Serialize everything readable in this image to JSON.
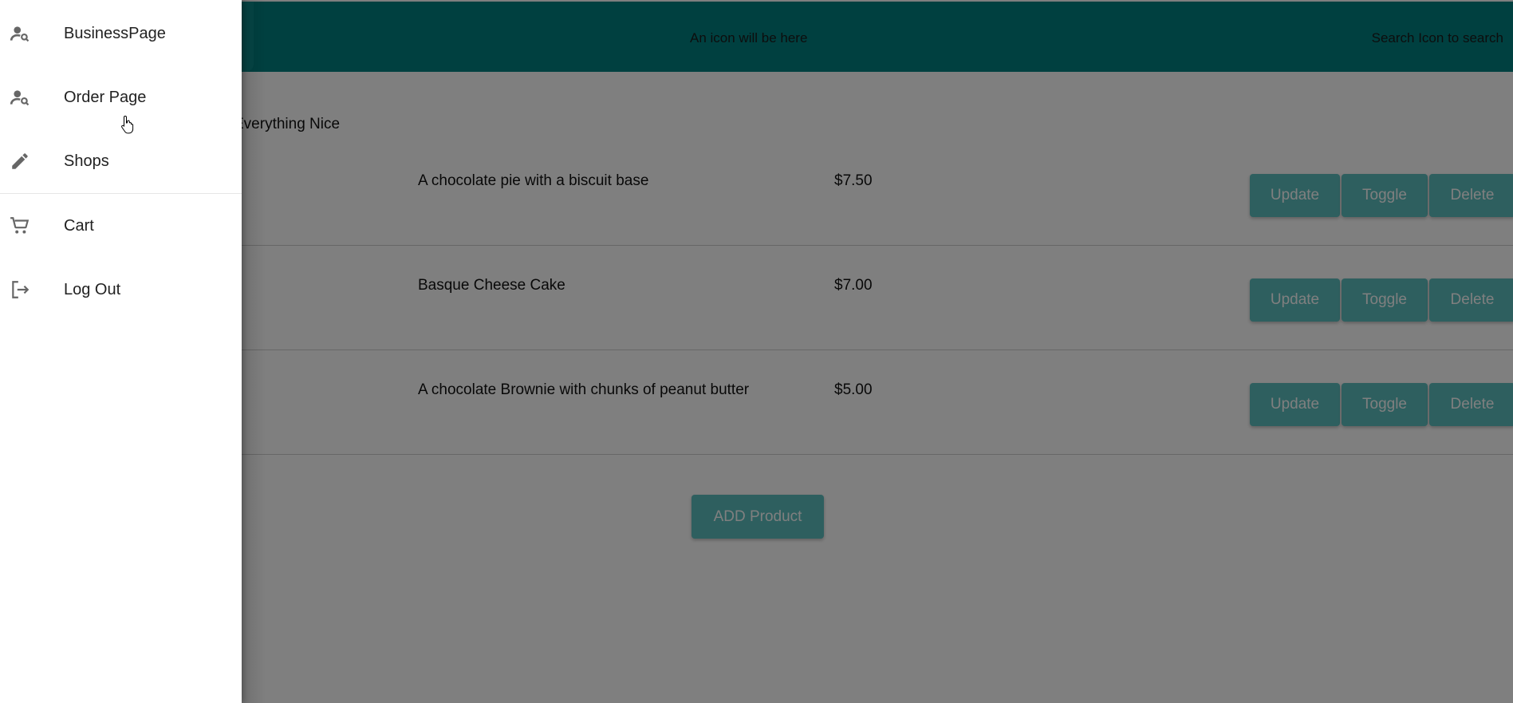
{
  "header": {
    "center_text": "An icon will be here",
    "right_text": "Search Icon to search"
  },
  "shop": {
    "name": "Everything Nice"
  },
  "products": [
    {
      "description": "A chocolate pie with a biscuit base",
      "price": "$7.50"
    },
    {
      "description": "Basque Cheese Cake",
      "price": "$7.00"
    },
    {
      "description": "A chocolate Brownie with chunks of peanut butter",
      "price": "$5.00"
    }
  ],
  "row_actions": {
    "update": "Update",
    "toggle": "Toggle",
    "delete": "Delete"
  },
  "add_product_label": "ADD Product",
  "drawer": {
    "items": [
      {
        "label": "BusinessPage",
        "icon": "person-search-icon"
      },
      {
        "label": "Order Page",
        "icon": "person-search-icon"
      },
      {
        "label": "Shops",
        "icon": "pencil-icon"
      },
      {
        "label": "Cart",
        "icon": "cart-icon"
      },
      {
        "label": "Log Out",
        "icon": "logout-icon"
      }
    ]
  },
  "colors": {
    "header": "#008080",
    "button": "#5cbfbf",
    "drawer_bg": "#ffffff",
    "backdrop": "rgba(0,0,0,0.5)"
  }
}
